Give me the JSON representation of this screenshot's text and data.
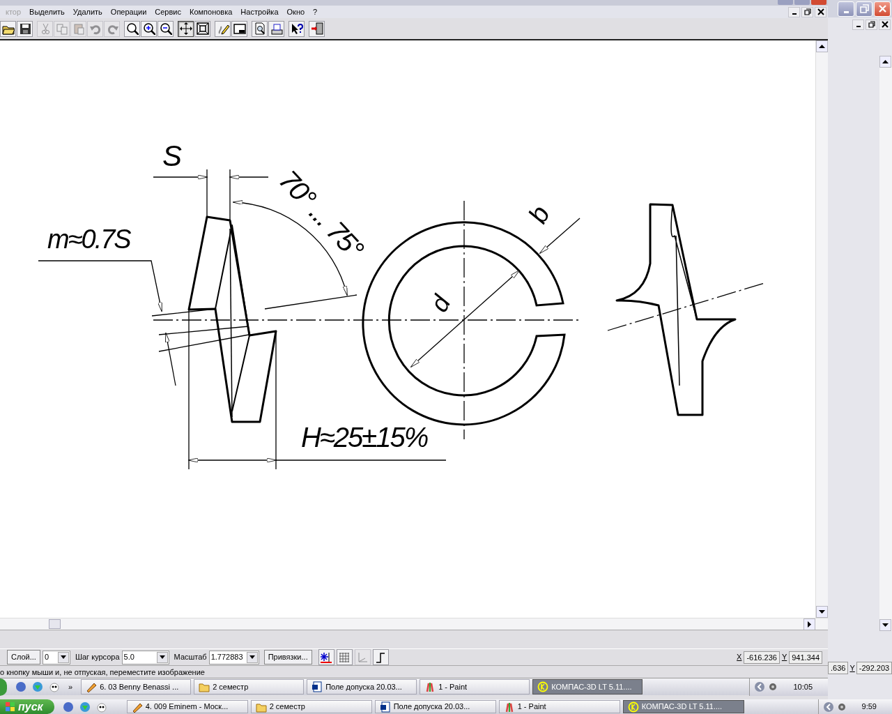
{
  "menu": [
    {
      "label": "ктор",
      "disabled": true
    },
    {
      "label": "Выделить",
      "disabled": false
    },
    {
      "label": "Удалить",
      "disabled": false
    },
    {
      "label": "Операции",
      "disabled": false
    },
    {
      "label": "Сервис",
      "disabled": false
    },
    {
      "label": "Компоновка",
      "disabled": false
    },
    {
      "label": "Настройка",
      "disabled": false
    },
    {
      "label": "Окно",
      "disabled": false
    },
    {
      "label": "?",
      "disabled": false
    }
  ],
  "toolbar": [
    {
      "kind": "open",
      "disabled": false,
      "selected": false
    },
    {
      "kind": "save",
      "disabled": false,
      "selected": false
    },
    {
      "kind": "sep"
    },
    {
      "kind": "cut",
      "disabled": true,
      "selected": false
    },
    {
      "kind": "copy",
      "disabled": true,
      "selected": false
    },
    {
      "kind": "paste",
      "disabled": true,
      "selected": false
    },
    {
      "kind": "undo",
      "disabled": true,
      "selected": false
    },
    {
      "kind": "redo",
      "disabled": true,
      "selected": false
    },
    {
      "kind": "sep"
    },
    {
      "kind": "zoom",
      "disabled": false,
      "selected": false
    },
    {
      "kind": "zoom-in",
      "disabled": false,
      "selected": false
    },
    {
      "kind": "zoom-out",
      "disabled": false,
      "selected": false
    },
    {
      "kind": "sep"
    },
    {
      "kind": "pan",
      "disabled": false,
      "selected": true
    },
    {
      "kind": "fit",
      "disabled": false,
      "selected": false
    },
    {
      "kind": "sep"
    },
    {
      "kind": "pencil",
      "disabled": false,
      "selected": false
    },
    {
      "kind": "window",
      "disabled": false,
      "selected": false
    },
    {
      "kind": "sep"
    },
    {
      "kind": "preview",
      "disabled": false,
      "selected": false
    },
    {
      "kind": "print",
      "disabled": false,
      "selected": false
    },
    {
      "kind": "sep"
    },
    {
      "kind": "help",
      "disabled": false,
      "selected": false
    },
    {
      "kind": "sep"
    },
    {
      "kind": "exit",
      "disabled": false,
      "selected": false
    }
  ],
  "drawing": {
    "labels": [
      "S",
      "70° ... 75°",
      "m≈0.7S",
      "b",
      "d",
      "H≈25±15%"
    ]
  },
  "bottom_toolbar": {
    "layer_button": "Слой...",
    "layer_value": "0",
    "step_label": "Шаг курсора",
    "step_value": "5.0",
    "scale_label": "Масштаб",
    "scale_value": "1.772883",
    "snaps_button": "Привязки...",
    "tools": [
      {
        "kind": "snap",
        "disabled": false
      },
      {
        "kind": "grid",
        "disabled": false
      },
      {
        "kind": "axes",
        "disabled": true
      },
      {
        "kind": "ortho",
        "disabled": false
      }
    ],
    "x_label": "X",
    "x_value": "-616.236",
    "y_label": "Y",
    "y_value": "941.344"
  },
  "status_text": "о кнопку мыши и, не отпуская, переместите изображение",
  "taskbar": {
    "quick_more": "»",
    "tasks": [
      {
        "label": "6. 03 Benny Benassi ...",
        "kind": "player",
        "selected": false
      },
      {
        "label": "2 семестр",
        "kind": "folder",
        "selected": false
      },
      {
        "label": "Поле допуска 20.03...",
        "kind": "word",
        "selected": false
      },
      {
        "label": "1 - Paint",
        "kind": "paint",
        "selected": false
      },
      {
        "label": "КОМПАС-3D LT 5.11....",
        "kind": "kompas",
        "selected": true
      }
    ],
    "clock": "10:05"
  },
  "background_window": {
    "x_value": ".636",
    "y_label": "Y",
    "y_value": "-292.203"
  },
  "background_taskbar": {
    "start": "пуск",
    "tasks": [
      {
        "label": "4. 009 Eminem - Моск...",
        "kind": "player",
        "selected": false
      },
      {
        "label": "2 семестр",
        "kind": "folder",
        "selected": false
      },
      {
        "label": "Поле допуска 20.03...",
        "kind": "word",
        "selected": false
      },
      {
        "label": "1 - Paint",
        "kind": "paint",
        "selected": false
      },
      {
        "label": "КОМПАС-3D LT 5.11....",
        "kind": "kompas",
        "selected": true
      }
    ],
    "clock": "9:59"
  }
}
